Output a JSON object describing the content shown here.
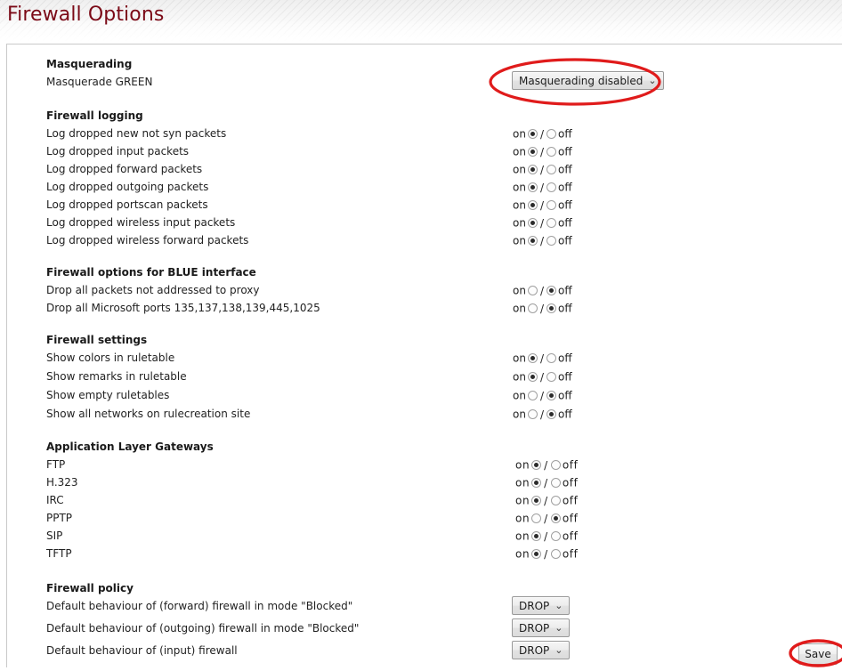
{
  "header": {
    "title": "Firewall Options"
  },
  "sections": [
    {
      "id": "masquerading",
      "heading": "Masquerading",
      "rows": [
        {
          "label": "Masquerade GREEN",
          "control": "select",
          "value": "Masquerading disabled",
          "chevron": "⌄"
        }
      ]
    },
    {
      "id": "firewall-logging",
      "heading": "Firewall logging",
      "rows": [
        {
          "label": "Log dropped new not syn packets",
          "control": "radio",
          "on_label": "on",
          "off_label": "off",
          "separator": "/",
          "value": "on"
        },
        {
          "label": "Log dropped input packets",
          "control": "radio",
          "on_label": "on",
          "off_label": "off",
          "separator": "/",
          "value": "on"
        },
        {
          "label": "Log dropped forward packets",
          "control": "radio",
          "on_label": "on",
          "off_label": "off",
          "separator": "/",
          "value": "on"
        },
        {
          "label": "Log dropped outgoing packets",
          "control": "radio",
          "on_label": "on",
          "off_label": "off",
          "separator": "/",
          "value": "on"
        },
        {
          "label": "Log dropped portscan packets",
          "control": "radio",
          "on_label": "on",
          "off_label": "off",
          "separator": "/",
          "value": "on"
        },
        {
          "label": "Log dropped wireless input packets",
          "control": "radio",
          "on_label": "on",
          "off_label": "off",
          "separator": "/",
          "value": "on"
        },
        {
          "label": "Log dropped wireless forward packets",
          "control": "radio",
          "on_label": "on",
          "off_label": "off",
          "separator": "/",
          "value": "on"
        }
      ]
    },
    {
      "id": "blue-interface",
      "heading": "Firewall options for BLUE interface",
      "rows": [
        {
          "label": "Drop all packets not addressed to proxy",
          "control": "radio",
          "on_label": "on",
          "off_label": "off",
          "separator": "/",
          "value": "off"
        },
        {
          "label": "Drop all Microsoft ports 135,137,138,139,445,1025",
          "control": "radio",
          "on_label": "on",
          "off_label": "off",
          "separator": "/",
          "value": "off"
        }
      ]
    },
    {
      "id": "firewall-settings",
      "heading": "Firewall settings",
      "rows": [
        {
          "label": "Show colors in ruletable",
          "control": "radio",
          "on_label": "on",
          "off_label": "off",
          "separator": "/",
          "value": "on"
        },
        {
          "label": "Show remarks in ruletable",
          "control": "radio",
          "on_label": "on",
          "off_label": "off",
          "separator": "/",
          "value": "on"
        },
        {
          "label": "Show empty ruletables",
          "control": "radio",
          "on_label": "on",
          "off_label": "off",
          "separator": "/",
          "value": "off"
        },
        {
          "label": "Show all networks on rulecreation site",
          "control": "radio",
          "on_label": "on",
          "off_label": "off",
          "separator": "/",
          "value": "off"
        }
      ]
    },
    {
      "id": "application-layer-gateways",
      "heading": "Application Layer Gateways",
      "rows": [
        {
          "label": "FTP",
          "control": "radio",
          "on_label": "on",
          "off_label": "off",
          "separator": "/",
          "value": "on"
        },
        {
          "label": "H.323",
          "control": "radio",
          "on_label": "on",
          "off_label": "off",
          "separator": "/",
          "value": "on"
        },
        {
          "label": "IRC",
          "control": "radio",
          "on_label": "on",
          "off_label": "off",
          "separator": "/",
          "value": "on"
        },
        {
          "label": "PPTP",
          "control": "radio",
          "on_label": "on",
          "off_label": "off",
          "separator": "/",
          "value": "off"
        },
        {
          "label": "SIP",
          "control": "radio",
          "on_label": "on",
          "off_label": "off",
          "separator": "/",
          "value": "on"
        },
        {
          "label": "TFTP",
          "control": "radio",
          "on_label": "on",
          "off_label": "off",
          "separator": "/",
          "value": "on"
        }
      ]
    },
    {
      "id": "firewall-policy",
      "heading": "Firewall policy",
      "rows": [
        {
          "label": "Default behaviour of (forward) firewall in mode \"Blocked\"",
          "control": "select",
          "value": "DROP",
          "chevron": "⌄"
        },
        {
          "label": "Default behaviour of (outgoing) firewall in mode \"Blocked\"",
          "control": "select",
          "value": "DROP",
          "chevron": "⌄"
        },
        {
          "label": "Default behaviour of (input) firewall",
          "control": "select",
          "value": "DROP",
          "chevron": "⌄"
        }
      ]
    }
  ],
  "save": {
    "label": "Save"
  },
  "annotations": {
    "color": "#e01b1b",
    "masquerading_target": "masquerading-select",
    "save_target": "save-button"
  }
}
